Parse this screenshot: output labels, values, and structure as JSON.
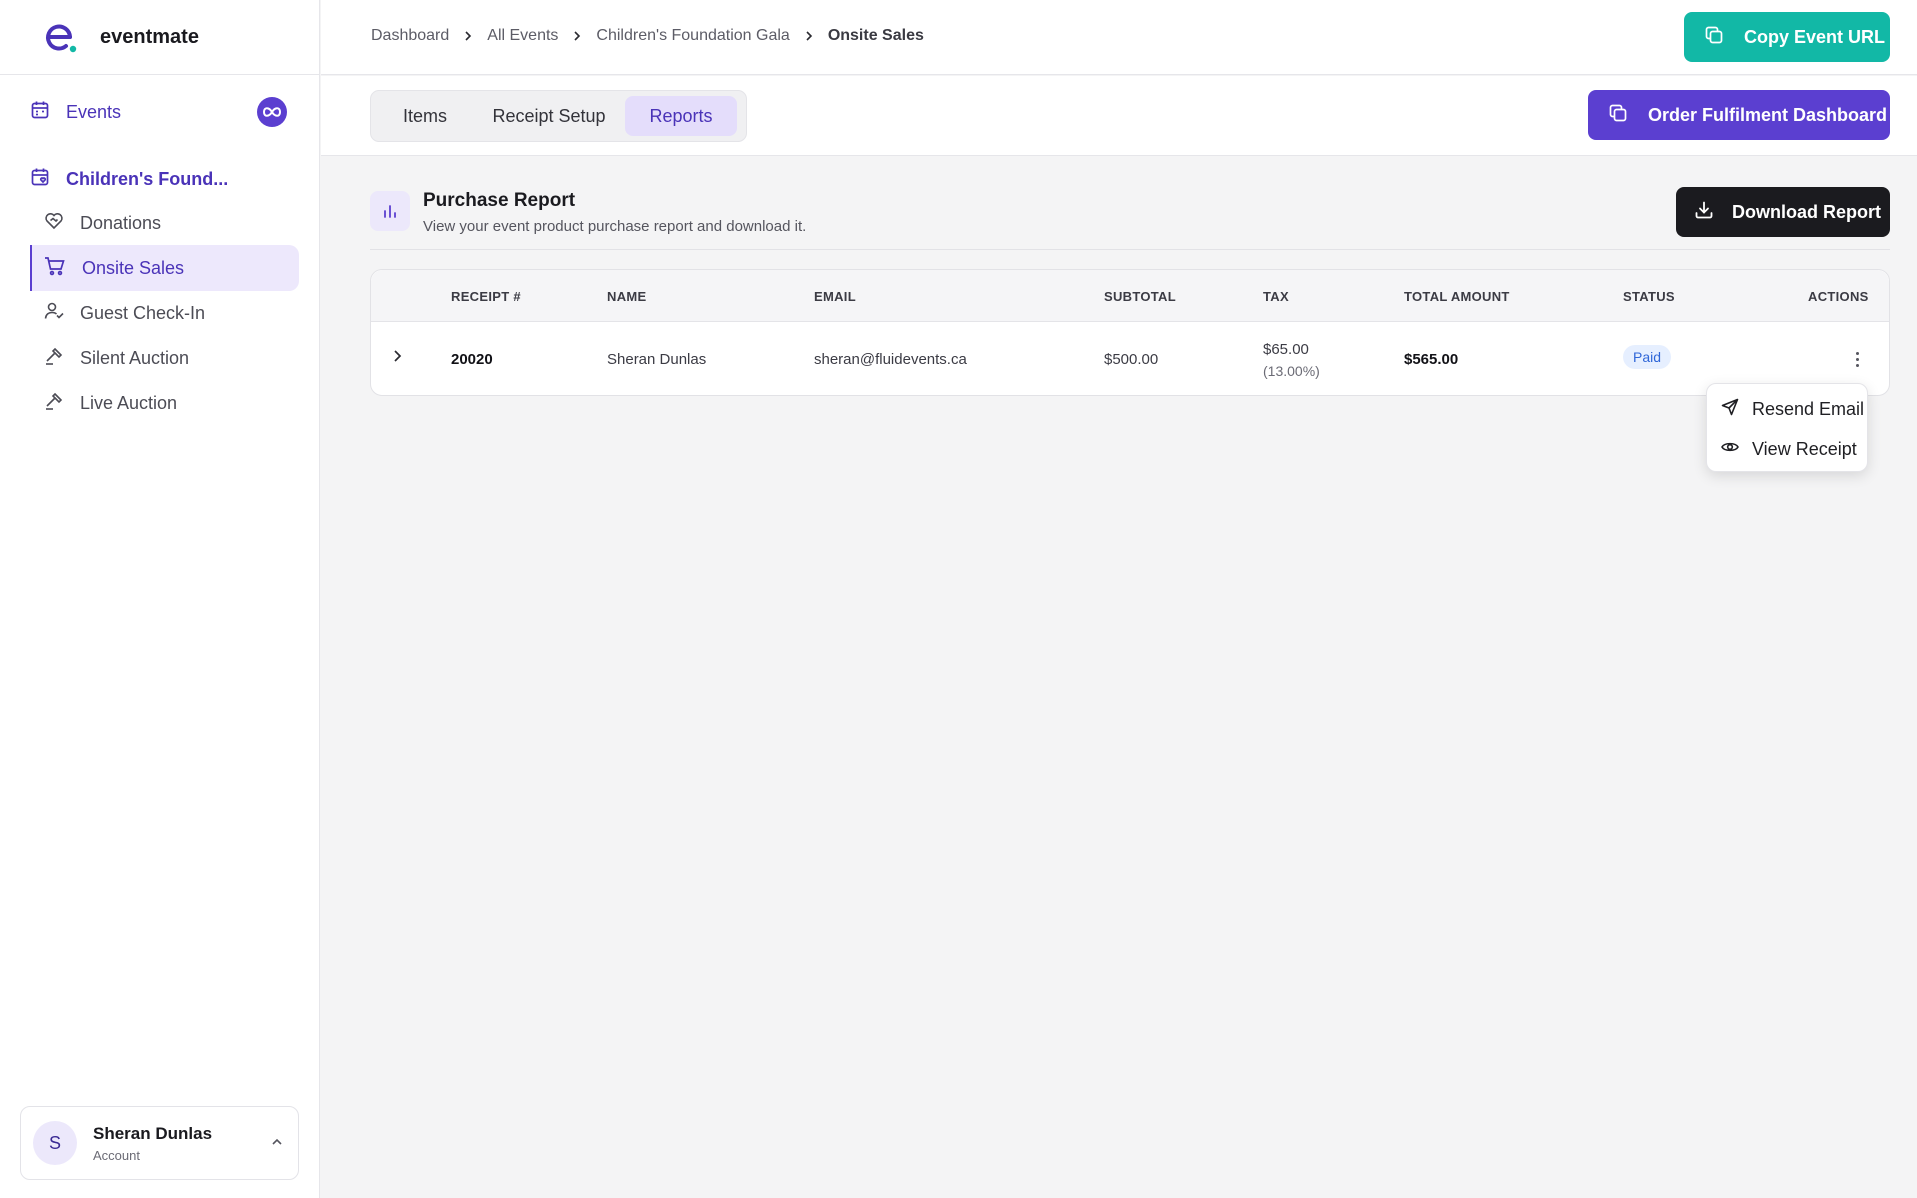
{
  "brand": {
    "name": "eventmate"
  },
  "sidebar": {
    "events_label": "Events",
    "event_name": "Children's Found...",
    "items": [
      {
        "label": "Donations",
        "icon": "heart-handshake-icon"
      },
      {
        "label": "Onsite Sales",
        "icon": "cart-icon",
        "active": true
      },
      {
        "label": "Guest Check-In",
        "icon": "user-check-icon"
      },
      {
        "label": "Silent Auction",
        "icon": "gavel-icon"
      },
      {
        "label": "Live Auction",
        "icon": "gavel-icon"
      }
    ],
    "account": {
      "initial": "S",
      "name": "Sheran Dunlas",
      "sub": "Account"
    }
  },
  "breadcrumb": [
    "Dashboard",
    "All Events",
    "Children's Foundation Gala",
    "Onsite Sales"
  ],
  "header": {
    "copy_url_label": "Copy Event URL"
  },
  "tabs": [
    {
      "label": "Items"
    },
    {
      "label": "Receipt Setup"
    },
    {
      "label": "Reports",
      "active": true
    }
  ],
  "order_dashboard_label": "Order Fulfilment Dashboard",
  "report": {
    "title": "Purchase Report",
    "subtitle": "View your event product purchase report and download it.",
    "download_label": "Download Report"
  },
  "table": {
    "columns": [
      "RECEIPT #",
      "NAME",
      "EMAIL",
      "SUBTOTAL",
      "TAX",
      "TOTAL AMOUNT",
      "STATUS",
      "ACTIONS"
    ],
    "rows": [
      {
        "receipt": "20020",
        "name": "Sheran Dunlas",
        "email": "sheran@fluidevents.ca",
        "subtotal": "$500.00",
        "tax": "$65.00",
        "tax_rate": "(13.00%)",
        "total": "$565.00",
        "status": "Paid"
      }
    ]
  },
  "actions_menu": [
    {
      "label": "Resend Email",
      "icon": "send-icon"
    },
    {
      "label": "View Receipt",
      "icon": "eye-icon"
    }
  ],
  "colors": {
    "primary": "#5b3fd0",
    "teal": "#12b8a6",
    "dark": "#1b1b1f",
    "paid_badge_bg": "#e6efff",
    "paid_badge_text": "#2f66d8"
  }
}
